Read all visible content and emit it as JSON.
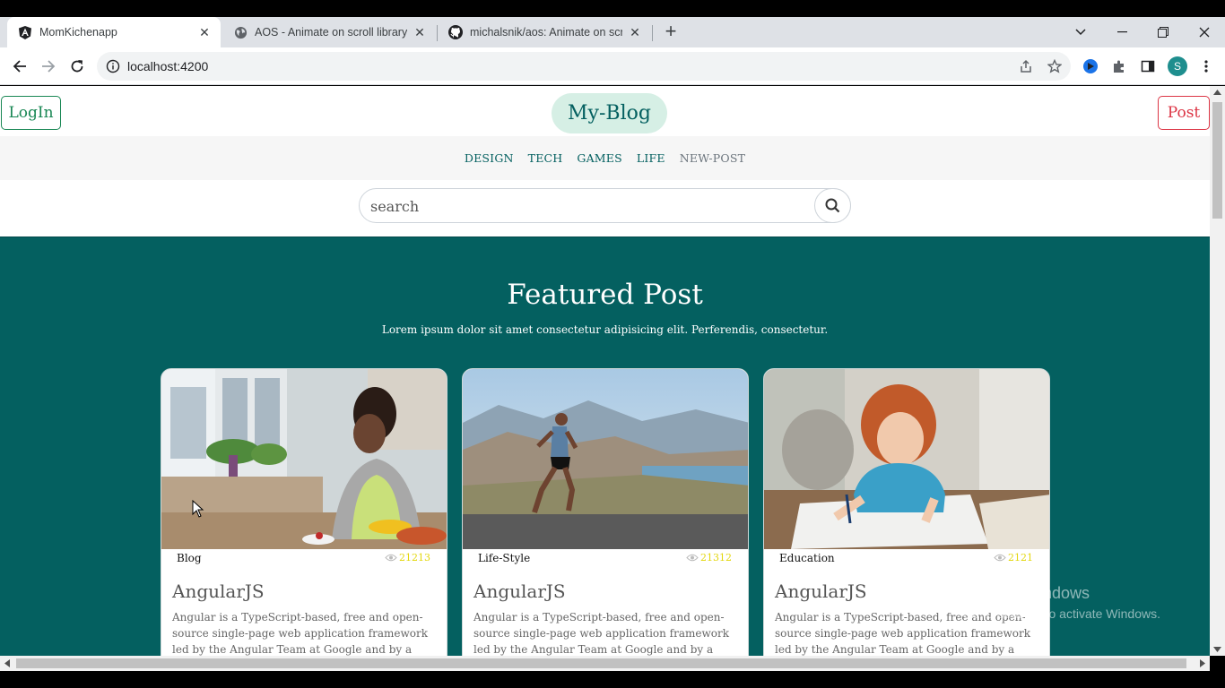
{
  "browser": {
    "tabs": [
      {
        "title": "MomKichenapp",
        "favicon": "angular-icon",
        "active": true
      },
      {
        "title": "AOS - Animate on scroll library",
        "favicon": "globe-icon",
        "active": false
      },
      {
        "title": "michalsnik/aos: Animate on scro",
        "favicon": "github-icon",
        "active": false
      }
    ],
    "url": "localhost:4200",
    "profile_initial": "S"
  },
  "header": {
    "login_label": "LogIn",
    "brand": "My-Blog",
    "post_label": "Post"
  },
  "nav": {
    "items": [
      "DESIGN",
      "TECH",
      "GAMES",
      "LIFE",
      "NEW-POST"
    ]
  },
  "search": {
    "placeholder": "search"
  },
  "featured": {
    "title": "Featured Post",
    "subtitle": "Lorem ipsum dolor sit amet consectetur adipisicing elit. Perferendis, consectetur.",
    "cards": [
      {
        "category": "Blog",
        "views": "21213",
        "title": "AngularJS",
        "description": "Angular is a TypeScript-based, free and open-source single-page web application framework led by the Angular Team at Google and by a community of",
        "image": "woman-cooking-kitchen"
      },
      {
        "category": "Life-Style",
        "views": "21312",
        "title": "AngularJS",
        "description": "Angular is a TypeScript-based, free and open-source single-page web application framework led by the Angular Team at Google and by a community of",
        "image": "man-running-road"
      },
      {
        "category": "Education",
        "views": "2121",
        "title": "AngularJS",
        "description": "Angular is a TypeScript-based, free and open-source single-page web application framework led by the Angular Team at Google and by a community of",
        "image": "girl-drawing-desk"
      }
    ]
  },
  "watermark": {
    "line1": "Activate Windows",
    "line2": "Go to Settings to activate Windows."
  },
  "colors": {
    "teal": "#046060",
    "brand_bg": "#d6efe5",
    "login": "#198754",
    "post": "#dc3545",
    "views": "#e3d70b"
  }
}
